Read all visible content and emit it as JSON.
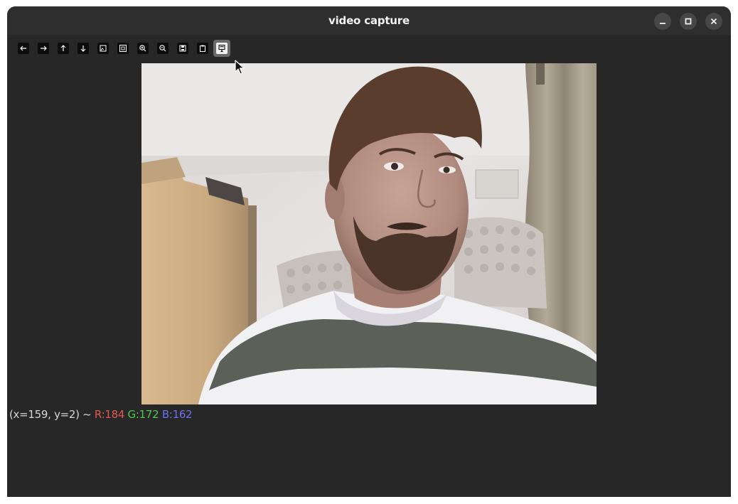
{
  "window": {
    "title": "video capture",
    "controls": [
      {
        "name": "minimize-button",
        "icon": "minimize-icon"
      },
      {
        "name": "maximize-button",
        "icon": "maximize-icon"
      },
      {
        "name": "close-button",
        "icon": "close-icon"
      }
    ]
  },
  "toolbar": {
    "buttons": [
      {
        "name": "pan-left-button",
        "icon": "arrow-left-icon"
      },
      {
        "name": "pan-right-button",
        "icon": "arrow-right-icon"
      },
      {
        "name": "pan-up-button",
        "icon": "arrow-up-icon"
      },
      {
        "name": "pan-down-button",
        "icon": "arrow-down-icon"
      },
      {
        "name": "zoom-original-button",
        "icon": "image-icon"
      },
      {
        "name": "zoom-fit-button",
        "icon": "image-fit-icon"
      },
      {
        "name": "zoom-in-button",
        "icon": "zoom-in-icon"
      },
      {
        "name": "zoom-out-button",
        "icon": "zoom-out-icon"
      },
      {
        "name": "save-image-button",
        "icon": "save-icon"
      },
      {
        "name": "copy-clipboard-button",
        "icon": "clipboard-icon"
      },
      {
        "name": "properties-button",
        "icon": "properties-icon",
        "active": true
      }
    ]
  },
  "video": {
    "subject": "webcam frame: bearded man in striped t-shirt, wardrobe and curtain in background"
  },
  "status": {
    "coords": "(x=159, y=2) ~",
    "r": "R:184",
    "g": "G:172",
    "b": "B:162",
    "r_color": "#e0594f",
    "g_color": "#4ecb4e",
    "b_color": "#6f6ff0"
  }
}
